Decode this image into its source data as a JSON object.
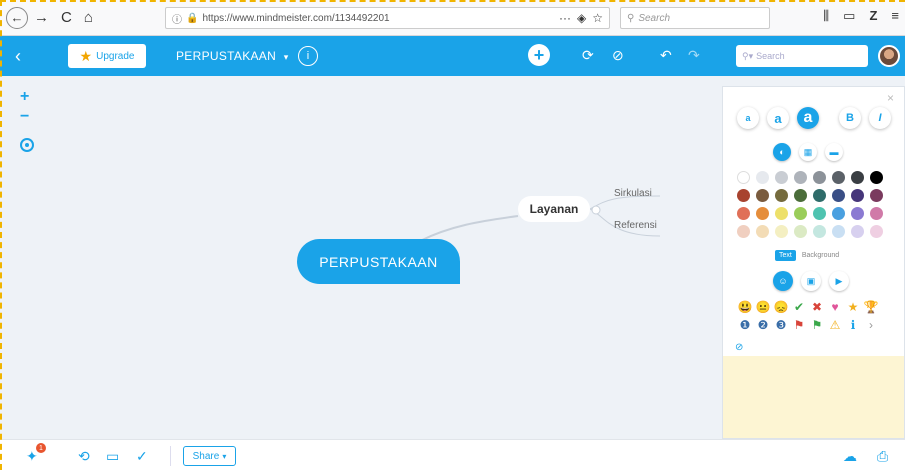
{
  "browser": {
    "url": "https://www.mindmeister.com/1134492201",
    "search_placeholder": "Search",
    "back": "←",
    "forward": "→",
    "reload": "C",
    "home": "⌂",
    "menu_more": "···"
  },
  "toolbar": {
    "back": "‹",
    "upgrade_label": "Upgrade",
    "map_title": "PERPUSTAKAAN",
    "map_title_caret": "▾",
    "info": "i",
    "add": "+",
    "search_placeholder": "Search"
  },
  "canvas": {
    "zoom_in": "+",
    "zoom_out": "−",
    "root_node": "PERPUSTAKAAN",
    "child_node": "Layanan",
    "sub_nodes": [
      "Sirkulasi",
      "Referensi"
    ]
  },
  "panel": {
    "close": "×",
    "font_sizes": [
      "a",
      "a",
      "a"
    ],
    "bold": "B",
    "italic": "I",
    "text_toggle": "Text",
    "background_toggle": "Background",
    "colors": [
      "#ffffff",
      "#e6e9ee",
      "#c9cdd3",
      "#aeb3ba",
      "#8c9299",
      "#5b6168",
      "#3a3e43",
      "#000000",
      "#a8432f",
      "#7a5b3e",
      "#756b3d",
      "#4b6d3a",
      "#2f6c6a",
      "#3a4f86",
      "#46367a",
      "#7a3a5e",
      "#e07058",
      "#e58d3b",
      "#ede06a",
      "#9acd5a",
      "#4fc3b0",
      "#4aa0e0",
      "#8b7ad2",
      "#d07aa8",
      "#f0cfc0",
      "#f3dcb6",
      "#f4efc2",
      "#dbeac4",
      "#c4e7e0",
      "#c9dff3",
      "#d7d0ef",
      "#efcfe2"
    ],
    "emoji_icons": [
      "😃",
      "😐",
      "😞",
      "✔",
      "✖",
      "♥",
      "★",
      "🏆",
      "❶",
      "❷",
      "❸",
      "⚑",
      "⚑",
      "⚠",
      "ℹ",
      "›"
    ],
    "no_icon": "⊘"
  },
  "footer": {
    "notification_count": "1",
    "share_label": "Share",
    "share_caret": "▾"
  }
}
